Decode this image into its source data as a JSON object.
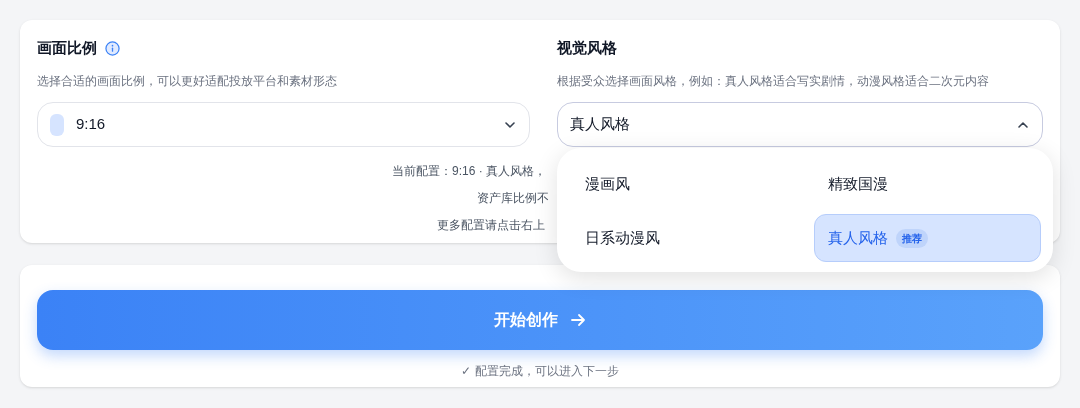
{
  "ratio": {
    "title": "画面比例",
    "description": "选择合适的画面比例，可以更好适配投放平台和素材形态",
    "value": "9:16",
    "expanded": false
  },
  "style": {
    "title": "视觉风格",
    "description": "根据受众选择画面风格，例如：真人风格适合写实剧情，动漫风格适合二次元内容",
    "value": "真人风格",
    "expanded": true,
    "options": [
      {
        "label": "漫画风",
        "selected": false
      },
      {
        "label": "精致国漫",
        "selected": false
      },
      {
        "label": "日系动漫风",
        "selected": false
      },
      {
        "label": "真人风格",
        "selected": true,
        "badge": "推荐"
      }
    ]
  },
  "summary": [
    "当前配置：9:16 · 真人风格，",
    "资产库比例不",
    "更多配置请点击右上"
  ],
  "start_button": {
    "label": "开始创作"
  },
  "status": "✓ 配置完成，可以进入下一步"
}
